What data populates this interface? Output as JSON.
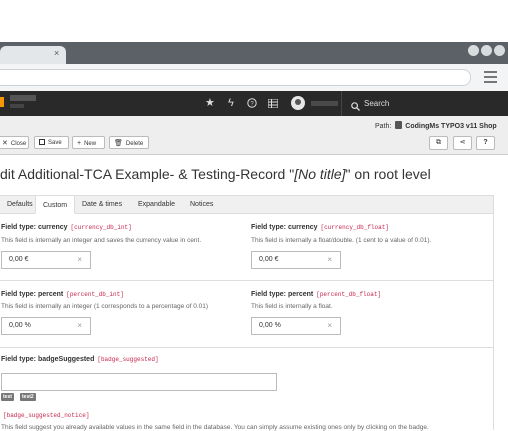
{
  "browser": {
    "tab_close": "×",
    "menu_icon": "hamburger-icon"
  },
  "topbar": {
    "search_label": "Search",
    "icons": [
      "star-icon",
      "bolt-icon",
      "help-icon",
      "list-icon",
      "avatar",
      "search-icon"
    ]
  },
  "docheader": {
    "path_label": "Path:",
    "path_value": "CodingMs TYPO3 v11 Shop",
    "buttons": {
      "close": "Close",
      "save": "Save",
      "new": "New",
      "delete": "Delete",
      "help": "?"
    }
  },
  "page": {
    "title_pre": "dit Additional-TCA Example- & Testing-Record \"",
    "title_italic": "[No title]",
    "title_post": "\" on root level"
  },
  "tabs": [
    "Defaults",
    "Custom",
    "Date & times",
    "Expandable",
    "Notices"
  ],
  "active_tab": "Custom",
  "fields": {
    "currency_int": {
      "label": "Field type: currency",
      "code": "[currency_db_int]",
      "desc": "This field is internally an integer and saves the currency value in cent.",
      "value": "0,00 €"
    },
    "currency_float": {
      "label": "Field type: currency",
      "code": "[currency_db_float]",
      "desc": "This field is internally a float/double. (1 cent to a value of 0.01).",
      "value": "0,00 €"
    },
    "percent_int": {
      "label": "Field type: percent",
      "code": "[percent_db_int]",
      "desc": "This field is internally an integer (1 corresponds to a percentage of 0.01)",
      "value": "0,00 %"
    },
    "percent_float": {
      "label": "Field type: percent",
      "code": "[percent_db_float]",
      "desc": "This field is internally a float.",
      "value": "0,00 %"
    },
    "badge": {
      "label": "Field type: badgeSuggested",
      "code": "[badge_suggested]",
      "value": "",
      "badges": [
        "test",
        "test2"
      ],
      "notice_code": "[badge_suggested_notice]",
      "notice": "This field suggest you already available values in the same field in the database. You can simply assume existing ones only by clicking on the badge."
    }
  },
  "clear_glyph": "×",
  "colors": {
    "topbar": "#292929",
    "accent": "#f49700",
    "code": "#c7254e"
  }
}
